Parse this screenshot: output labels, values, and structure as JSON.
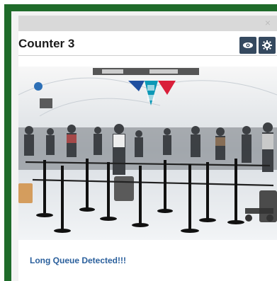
{
  "window": {
    "close_glyph": "×"
  },
  "panel": {
    "title": "Counter 3"
  },
  "buttons": [
    {
      "icon": "eye-icon"
    },
    {
      "icon": "gear-icon"
    }
  ],
  "alert": {
    "message": "Long Queue Detected!!!"
  }
}
